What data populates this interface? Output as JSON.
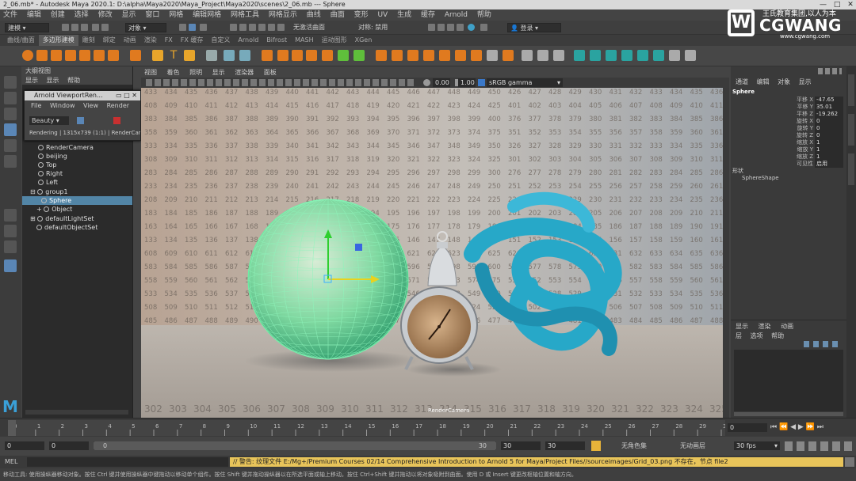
{
  "title_bar": {
    "text": "2_06.mb* - Autodesk Maya 2020.1: D:\\alpha\\Maya2020\\Maya_Project\\Maya2020\\scenes\\2_06.mb  ---  Sphere"
  },
  "menu": [
    "文件",
    "编辑",
    "创建",
    "选择",
    "修改",
    "显示",
    "窗口",
    "网格",
    "编辑网格",
    "网格工具",
    "网格显示",
    "曲线",
    "曲面",
    "变形",
    "UV",
    "生成",
    "缓存",
    "Arnold",
    "帮助"
  ],
  "status_line": {
    "menu_set": "建模",
    "object_label": "对象",
    "live_surface": "无激活曲面",
    "symmetry": "对称: 禁用",
    "login": "登录"
  },
  "shelf_tabs": [
    "曲线/曲面",
    "多边形建模",
    "雕刻",
    "绑定",
    "动画",
    "渲染",
    "FX",
    "FX 缓存",
    "自定义",
    "Arnold",
    "Bifrost",
    "MASH",
    "运动图形",
    "XGen"
  ],
  "shelf_active": "多边形建模",
  "outliner": {
    "title": "大纲视图",
    "menu": [
      "显示",
      "显示",
      "帮助"
    ],
    "items": [
      "RenderCamera",
      "beijing",
      "Top",
      "Right",
      "Left",
      "group1",
      "Sphere",
      "Object",
      "defaultLightSet",
      "defaultObjectSet"
    ],
    "selected": "Sphere"
  },
  "arnold_window": {
    "title": "Arnold ViewportRen...",
    "menu": [
      "File",
      "Window",
      "View",
      "Render"
    ],
    "aov": "Beauty",
    "status": "Rendering | 1315x739 (1:1) | RenderCam"
  },
  "viewport": {
    "menu": [
      "视图",
      "着色",
      "照明",
      "显示",
      "渲染器",
      "面板"
    ],
    "exposure": "0.00",
    "gamma": "1.00",
    "color_space": "sRGB gamma",
    "camera_label": "RenderCamera",
    "grid_numbers": [
      [
        "433",
        "434",
        "435",
        "436",
        "437",
        "438",
        "439",
        "440",
        "441",
        "442",
        "443",
        "444",
        "445",
        "446",
        "447",
        "448",
        "449",
        "450",
        "426",
        "427",
        "428",
        "429",
        "430",
        "431",
        "432",
        "433",
        "434",
        "435",
        "436"
      ],
      [
        "408",
        "409",
        "410",
        "411",
        "412",
        "413",
        "414",
        "415",
        "416",
        "417",
        "418",
        "419",
        "420",
        "421",
        "422",
        "423",
        "424",
        "425",
        "401",
        "402",
        "403",
        "404",
        "405",
        "406",
        "407",
        "408",
        "409",
        "410",
        "411"
      ],
      [
        "383",
        "384",
        "385",
        "386",
        "387",
        "388",
        "389",
        "390",
        "391",
        "392",
        "393",
        "394",
        "395",
        "396",
        "397",
        "398",
        "399",
        "400",
        "376",
        "377",
        "378",
        "379",
        "380",
        "381",
        "382",
        "383",
        "384",
        "385",
        "386"
      ],
      [
        "358",
        "359",
        "360",
        "361",
        "362",
        "363",
        "364",
        "365",
        "366",
        "367",
        "368",
        "369",
        "370",
        "371",
        "372",
        "373",
        "374",
        "375",
        "351",
        "352",
        "353",
        "354",
        "355",
        "356",
        "357",
        "358",
        "359",
        "360",
        "361"
      ],
      [
        "333",
        "334",
        "335",
        "336",
        "337",
        "338",
        "339",
        "340",
        "341",
        "342",
        "343",
        "344",
        "345",
        "346",
        "347",
        "348",
        "349",
        "350",
        "326",
        "327",
        "328",
        "329",
        "330",
        "331",
        "332",
        "333",
        "334",
        "335",
        "336"
      ],
      [
        "308",
        "309",
        "310",
        "311",
        "312",
        "313",
        "314",
        "315",
        "316",
        "317",
        "318",
        "319",
        "320",
        "321",
        "322",
        "323",
        "324",
        "325",
        "301",
        "302",
        "303",
        "304",
        "305",
        "306",
        "307",
        "308",
        "309",
        "310",
        "311"
      ],
      [
        "283",
        "284",
        "285",
        "286",
        "287",
        "288",
        "289",
        "290",
        "291",
        "292",
        "293",
        "294",
        "295",
        "296",
        "297",
        "298",
        "299",
        "300",
        "276",
        "277",
        "278",
        "279",
        "280",
        "281",
        "282",
        "283",
        "284",
        "285",
        "286"
      ],
      [
        "233",
        "234",
        "235",
        "236",
        "237",
        "238",
        "239",
        "240",
        "241",
        "242",
        "243",
        "244",
        "245",
        "246",
        "247",
        "248",
        "249",
        "250",
        "251",
        "252",
        "253",
        "254",
        "255",
        "256",
        "257",
        "258",
        "259",
        "260",
        "261"
      ],
      [
        "208",
        "209",
        "210",
        "211",
        "212",
        "213",
        "214",
        "215",
        "216",
        "217",
        "218",
        "219",
        "220",
        "221",
        "222",
        "223",
        "224",
        "225",
        "226",
        "227",
        "228",
        "229",
        "230",
        "231",
        "232",
        "233",
        "234",
        "235",
        "236"
      ],
      [
        "183",
        "184",
        "185",
        "186",
        "187",
        "188",
        "189",
        "190",
        "191",
        "192",
        "193",
        "194",
        "195",
        "196",
        "197",
        "198",
        "199",
        "200",
        "201",
        "202",
        "203",
        "204",
        "205",
        "206",
        "207",
        "208",
        "209",
        "210",
        "211"
      ],
      [
        "163",
        "164",
        "165",
        "166",
        "167",
        "168",
        "169",
        "170",
        "171",
        "172",
        "173",
        "174",
        "175",
        "176",
        "177",
        "178",
        "179",
        "180",
        "181",
        "182",
        "183",
        "184",
        "185",
        "186",
        "187",
        "188",
        "189",
        "190",
        "191"
      ],
      [
        "133",
        "134",
        "135",
        "136",
        "137",
        "138",
        "139",
        "140",
        "141",
        "142",
        "143",
        "144",
        "145",
        "146",
        "147",
        "148",
        "149",
        "150",
        "151",
        "152",
        "153",
        "154",
        "155",
        "156",
        "157",
        "158",
        "159",
        "160",
        "161"
      ],
      [
        "608",
        "609",
        "610",
        "611",
        "612",
        "613",
        "614",
        "615",
        "616",
        "617",
        "618",
        "619",
        "620",
        "621",
        "622",
        "623",
        "624",
        "625",
        "626",
        "627",
        "628",
        "629",
        "630",
        "631",
        "632",
        "633",
        "634",
        "635",
        "636"
      ],
      [
        "583",
        "584",
        "585",
        "586",
        "587",
        "588",
        "589",
        "590",
        "591",
        "592",
        "593",
        "594",
        "595",
        "596",
        "597",
        "598",
        "599",
        "600",
        "576",
        "577",
        "578",
        "579",
        "580",
        "581",
        "582",
        "583",
        "584",
        "585",
        "586"
      ],
      [
        "558",
        "559",
        "560",
        "561",
        "562",
        "563",
        "564",
        "565",
        "566",
        "567",
        "568",
        "569",
        "570",
        "571",
        "572",
        "573",
        "574",
        "575",
        "551",
        "552",
        "553",
        "554",
        "555",
        "556",
        "557",
        "558",
        "559",
        "560",
        "561"
      ],
      [
        "533",
        "534",
        "535",
        "536",
        "537",
        "538",
        "539",
        "540",
        "541",
        "542",
        "543",
        "544",
        "545",
        "546",
        "547",
        "548",
        "549",
        "550",
        "526",
        "527",
        "528",
        "529",
        "530",
        "531",
        "532",
        "533",
        "534",
        "535",
        "536"
      ],
      [
        "508",
        "509",
        "510",
        "511",
        "512",
        "513",
        "514",
        "515",
        "516",
        "517",
        "518",
        "519",
        "520",
        "521",
        "522",
        "523",
        "524",
        "525",
        "501",
        "502",
        "503",
        "504",
        "505",
        "506",
        "507",
        "508",
        "509",
        "510",
        "511"
      ],
      [
        "485",
        "486",
        "487",
        "488",
        "489",
        "490",
        "491",
        "492",
        "493",
        "494",
        "495",
        "496",
        "497",
        "498",
        "499",
        "500",
        "476",
        "477",
        "478",
        "479",
        "480",
        "481",
        "482",
        "483",
        "484",
        "485",
        "486",
        "487",
        "488"
      ]
    ],
    "floor_numbers": [
      "302",
      "303",
      "304",
      "305",
      "306",
      "307",
      "308",
      "309",
      "310",
      "311",
      "312",
      "313",
      "314",
      "315",
      "316",
      "317",
      "318",
      "319",
      "320",
      "321",
      "322",
      "323",
      "324",
      "325"
    ]
  },
  "attribute_editor": {
    "tabs": [
      "通道",
      "编辑",
      "对象",
      "显示"
    ],
    "object_name": "Sphere",
    "rows": [
      {
        "label": "平移 X",
        "value": "-47.65"
      },
      {
        "label": "平移 Y",
        "value": "35.01"
      },
      {
        "label": "平移 Z",
        "value": "-19.262"
      },
      {
        "label": "旋转 X",
        "value": "0"
      },
      {
        "label": "旋转 Y",
        "value": "0"
      },
      {
        "label": "旋转 Z",
        "value": "0"
      },
      {
        "label": "缩放 X",
        "value": "1"
      },
      {
        "label": "缩放 Y",
        "value": "1"
      },
      {
        "label": "缩放 Z",
        "value": "1"
      },
      {
        "label": "可见性",
        "value": "启用"
      }
    ],
    "shapes_label": "形状",
    "shape_name": "SphereShape"
  },
  "layer_editor": {
    "tabs": [
      "显示",
      "渲染",
      "动画"
    ],
    "menu": [
      "层",
      "选项",
      "帮助"
    ]
  },
  "timeline": {
    "ticks": [
      "0",
      "1",
      "2",
      "3",
      "4",
      "5",
      "6",
      "7",
      "8",
      "9",
      "10",
      "11",
      "12",
      "13",
      "14",
      "15",
      "16",
      "17",
      "18",
      "19",
      "20",
      "21",
      "22",
      "23",
      "24",
      "25",
      "26",
      "27",
      "28",
      "29",
      "30"
    ],
    "current_frame": "0"
  },
  "range": {
    "start": "0",
    "start_inner": "0",
    "slider_start": "0",
    "slider_end": "30",
    "end_inner": "30",
    "end": "30",
    "char_set": "无角色集",
    "anim_layer": "无动画层",
    "fps": "30 fps"
  },
  "command_line": {
    "lang": "MEL",
    "warning": "// 警告: 纹理文件 E:/Mg+/Premium Courses 02/14 Comprehensive Introduction to Arnold 5 for Maya/Project Files//sourceimages/Grid_03.png 不存在，节点 file2"
  },
  "help_line": "移动工具: 使用操纵器移动对象。按住 Ctrl 键并使用操纵器中键拖动以移动单个组件。按住 Shift 键并拖动操纵器以在所选平面或轴上移动。按住 Ctrl+Shift 键并拖动以将对象吸附到曲面。使用 D 或 Insert 键更改枢轴位置和轴方向。",
  "watermark": {
    "brand": "CGWANG",
    "tagline": "王氏教育集团,以人为本",
    "url": "www.cgwang.com"
  },
  "colors": {
    "selection": "#5285a6",
    "sphere_wire": "#66f0a0",
    "knot": "#23a6c6",
    "warning_bg": "#e8c45a"
  }
}
